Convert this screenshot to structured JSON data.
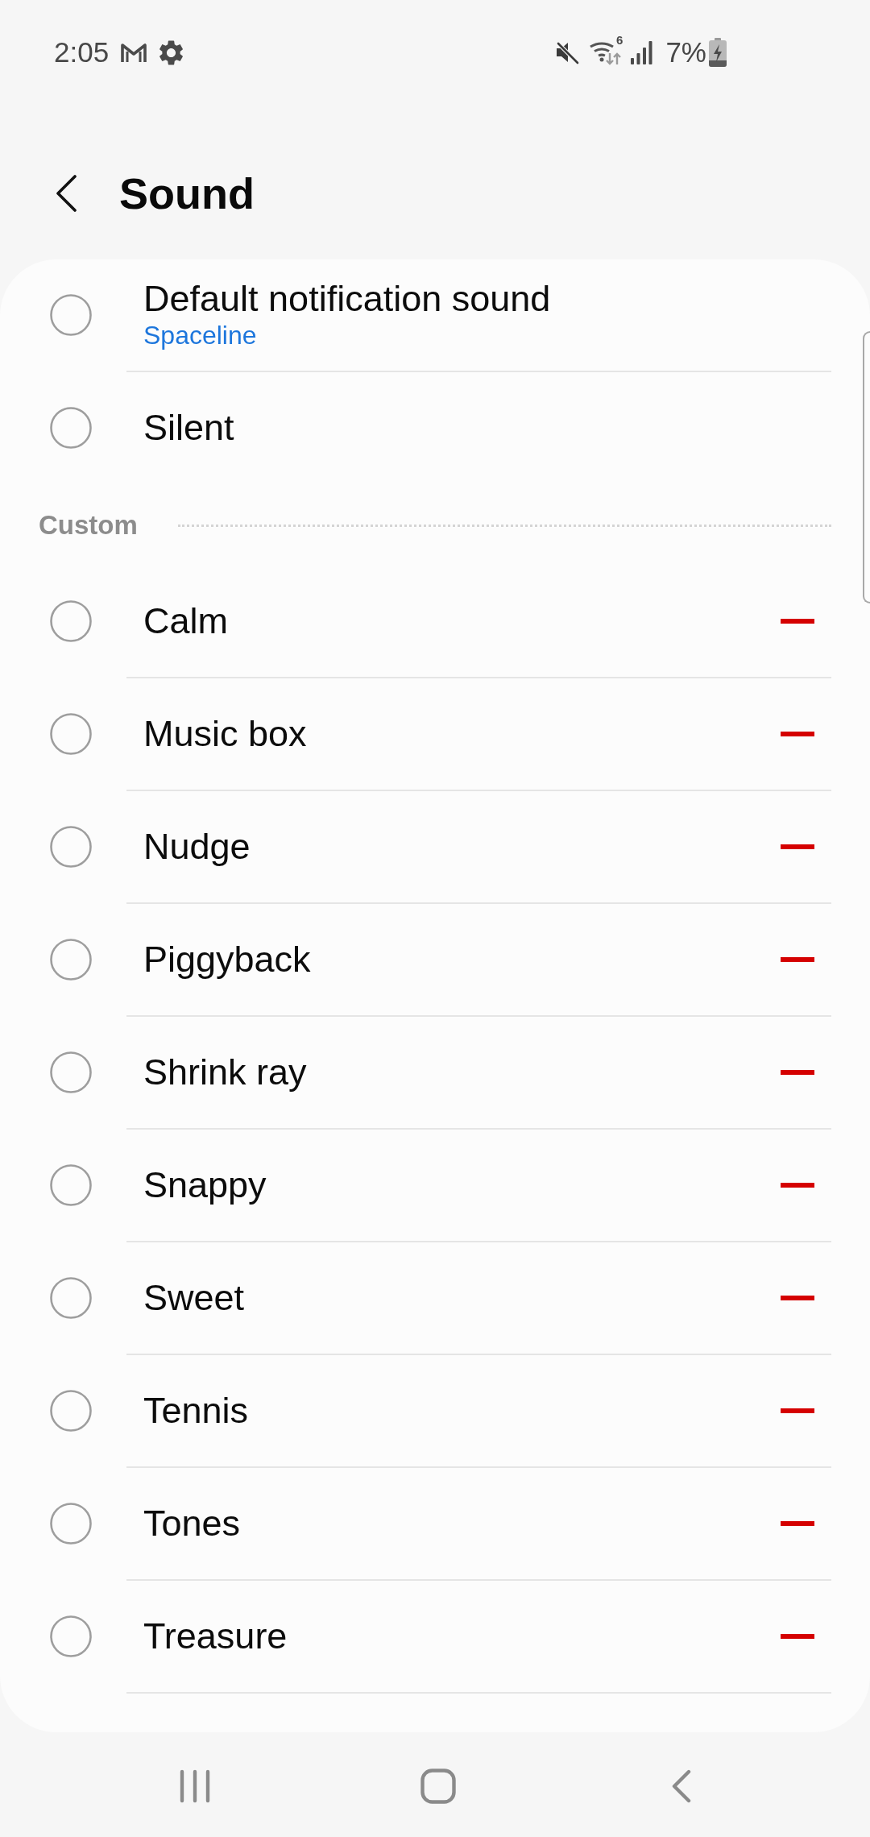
{
  "status_bar": {
    "time": "2:05",
    "wifi_badge": "6",
    "battery": "7%"
  },
  "header": {
    "title": "Sound"
  },
  "tones": [
    {
      "title": "Default notification sound",
      "subtitle": "Spaceline",
      "selected": false
    },
    {
      "title": "Silent",
      "selected": false
    }
  ],
  "custom": {
    "title": "Custom",
    "items": [
      {
        "title": "Calm",
        "selected": false
      },
      {
        "title": "Music box",
        "selected": false
      },
      {
        "title": "Nudge",
        "selected": false
      },
      {
        "title": "Piggyback",
        "selected": false
      },
      {
        "title": "Shrink ray",
        "selected": false
      },
      {
        "title": "Snappy",
        "selected": false
      },
      {
        "title": "Sweet",
        "selected": false
      },
      {
        "title": "Tennis",
        "selected": false
      },
      {
        "title": "Tones",
        "selected": false
      },
      {
        "title": "Treasure",
        "selected": false
      }
    ]
  }
}
